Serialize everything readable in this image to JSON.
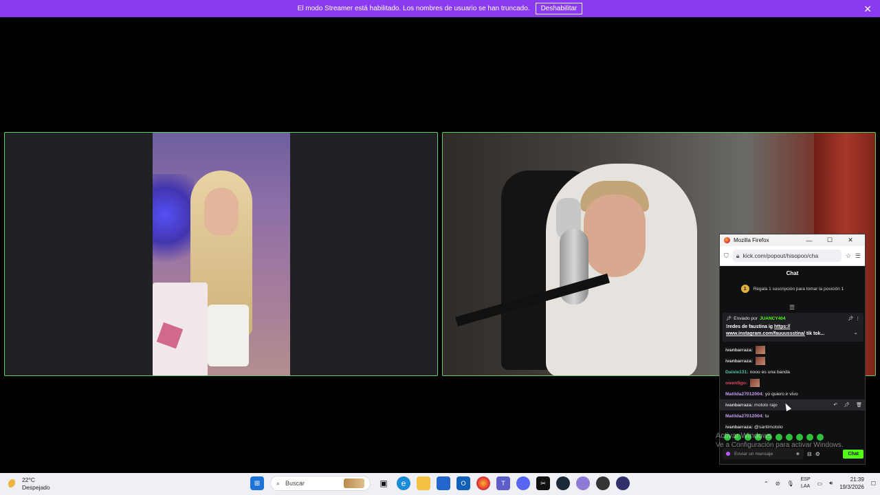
{
  "banner": {
    "message": "El modo Streamer está habilitado. Los nombres de usuario se han truncado.",
    "disable_label": "Deshabilitar",
    "close_symbol": "✕"
  },
  "firefox": {
    "title": "Mozilla Firefox",
    "url": "kick.com/popout/hisopoo/cha",
    "chat_header": "Chat",
    "gift_badge": "1",
    "gift_text": "Regala 1 suscripción para tomar la posición 1",
    "pinned": {
      "sent_by": "Enviado por",
      "user": "JUANCY404",
      "message_pre": "!redes de faustina ig ",
      "link": "https:// www.instagram.com/fauuussstina/",
      "message_post": " tik tok..."
    },
    "messages": [
      {
        "user": "ivanbarraza:",
        "text": "",
        "color": "#d9d9d9",
        "thumb": true
      },
      {
        "user": "ivanbarraza:",
        "text": "",
        "color": "#d9d9d9",
        "thumb": true
      },
      {
        "user": "Daisie131:",
        "text": "nooo es una banda",
        "color": "#4fc3a1",
        "thumb": false
      },
      {
        "user": "owenfigo:",
        "text": "",
        "color": "#e0455b",
        "thumb": true
      },
      {
        "user": "Matilda27012004:",
        "text": "yo quiero ir vivo",
        "color": "#c89cf0",
        "thumb": false
      },
      {
        "user": "ivanbarraza:",
        "text": "motolo rajo",
        "color": "#d9d9d9",
        "thumb": false,
        "hover": true
      },
      {
        "user": "Matilda27012004:",
        "text": "tu",
        "color": "#c89cf0",
        "thumb": false
      },
      {
        "user": "ivanbarraza:",
        "text": "@santimotolo",
        "color": "#d9d9d9",
        "thumb": false
      }
    ],
    "input_placeholder": "Enviar un mensaje",
    "send_label": "Chat"
  },
  "watermark": {
    "line1": "Activar Windows",
    "line2": "Ve a Configuración para activar Windows."
  },
  "taskbar": {
    "temperature": "22°C",
    "weather": "Despejado",
    "search_label": "Buscar",
    "lang1": "ESP",
    "lang2": "LAA",
    "time": "21:39",
    "date": "19/3/2026"
  },
  "colors": {
    "banner": "#8a3bf0",
    "tile_border": "#5fcf6b",
    "kick_green": "#53fc18"
  }
}
